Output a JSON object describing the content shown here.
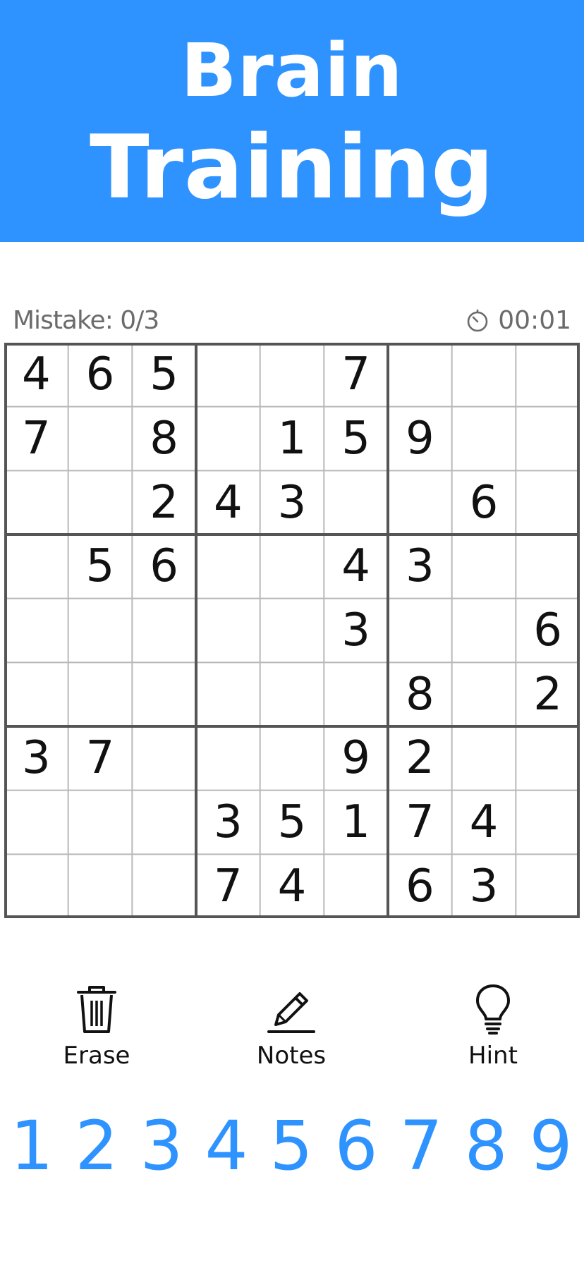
{
  "header": {
    "line1": "Brain",
    "line2": "Training",
    "background": "#2e93ff"
  },
  "status": {
    "mistakes": "Mistake: 0/3",
    "timer": "00:01",
    "timer_icon": "stopwatch-icon"
  },
  "board": [
    [
      "4",
      "6",
      "5",
      "",
      "",
      "7",
      "",
      "",
      ""
    ],
    [
      "7",
      "",
      "8",
      "",
      "1",
      "5",
      "9",
      "",
      ""
    ],
    [
      "",
      "",
      "2",
      "4",
      "3",
      "",
      "",
      "6",
      ""
    ],
    [
      "",
      "5",
      "6",
      "",
      "",
      "4",
      "3",
      "",
      ""
    ],
    [
      "",
      "",
      "",
      "",
      "",
      "3",
      "",
      "",
      "6"
    ],
    [
      "",
      "",
      "",
      "",
      "",
      "",
      "8",
      "",
      "2"
    ],
    [
      "3",
      "7",
      "",
      "",
      "",
      "9",
      "2",
      "",
      ""
    ],
    [
      "",
      "",
      "",
      "3",
      "5",
      "1",
      "7",
      "4",
      ""
    ],
    [
      "",
      "",
      "",
      "7",
      "4",
      "",
      "6",
      "3",
      ""
    ]
  ],
  "tools": [
    {
      "id": "erase",
      "label": "Erase",
      "icon": "trash-icon"
    },
    {
      "id": "notes",
      "label": "Notes",
      "icon": "pencil-icon"
    },
    {
      "id": "hint",
      "label": "Hint",
      "icon": "lightbulb-icon"
    }
  ],
  "numpad": [
    "1",
    "2",
    "3",
    "4",
    "5",
    "6",
    "7",
    "8",
    "9"
  ],
  "colors": {
    "accent": "#2e93ff",
    "grid_thick": "#555555",
    "grid_thin": "#b8b8b8",
    "text": "#111111",
    "muted": "#6b6b6b"
  }
}
